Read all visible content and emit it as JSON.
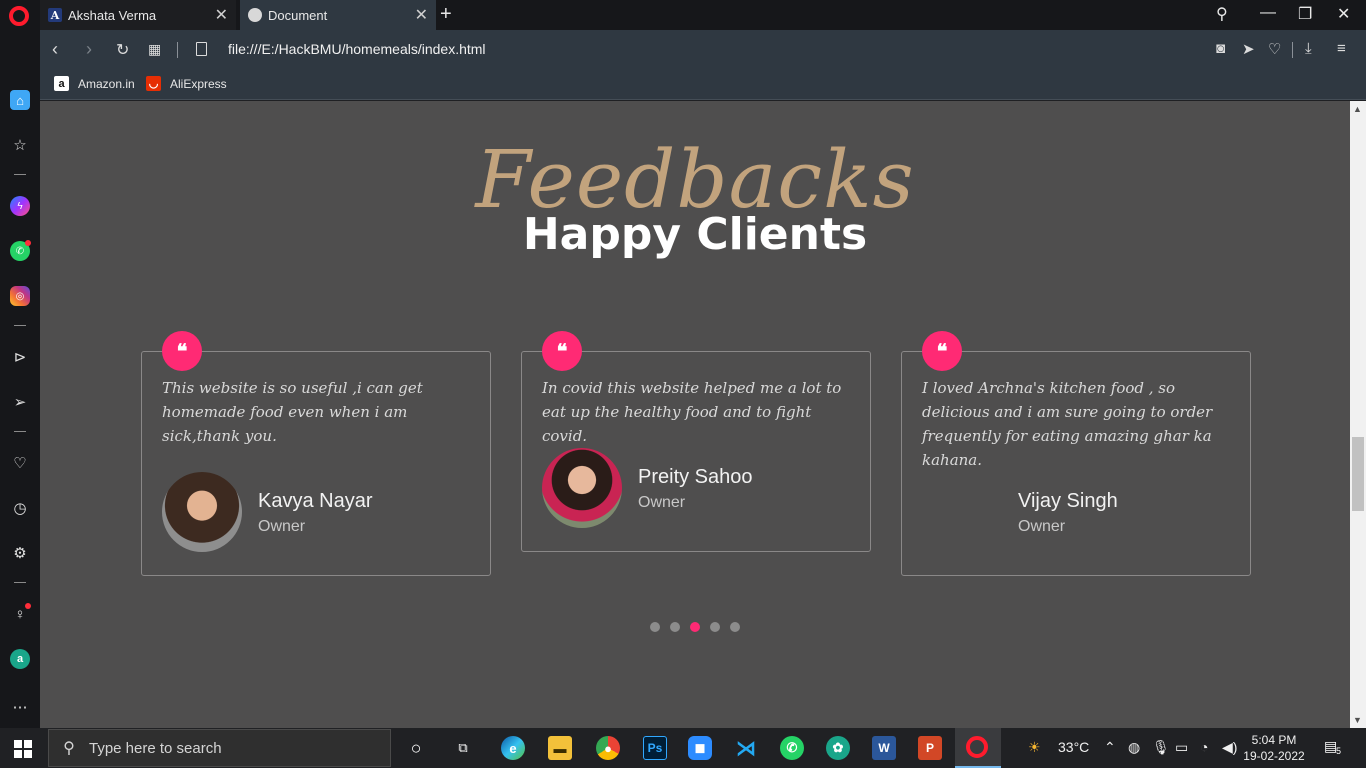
{
  "browser": {
    "tabs": [
      {
        "favicon": "A",
        "title": "Akshata Verma",
        "active": false
      },
      {
        "favicon": "globe-icon",
        "title": "Document",
        "active": true
      }
    ],
    "url": "file:///E:/HackBMU/homemeals/index.html",
    "bookmarks": [
      {
        "icon": "a",
        "label": "Amazon.in"
      },
      {
        "icon": "ali",
        "label": "AliExpress"
      }
    ]
  },
  "page": {
    "script_title": "Feedbacks",
    "title": "Happy Clients",
    "testimonials": [
      {
        "text": "This website is so useful ,i can get homemade food even when i am sick,thank you.",
        "name": "Kavya Nayar",
        "role": "Owner"
      },
      {
        "text": "In covid this website helped me a lot to eat up the healthy food and to fight covid.",
        "name": "Preity Sahoo",
        "role": "Owner"
      },
      {
        "text": "I loved Archna's kitchen food , so delicious and i am sure going to order frequently for eating amazing ghar ka kahana.",
        "name": "Vijay Singh",
        "role": "Owner"
      }
    ],
    "carousel": {
      "total": 5,
      "active_index": 2
    },
    "accent_color": "#ff2a74"
  },
  "taskbar": {
    "search_placeholder": "Type here to search",
    "weather": "33°C",
    "time": "5:04 PM",
    "date": "19-02-2022",
    "notifications": "5"
  }
}
